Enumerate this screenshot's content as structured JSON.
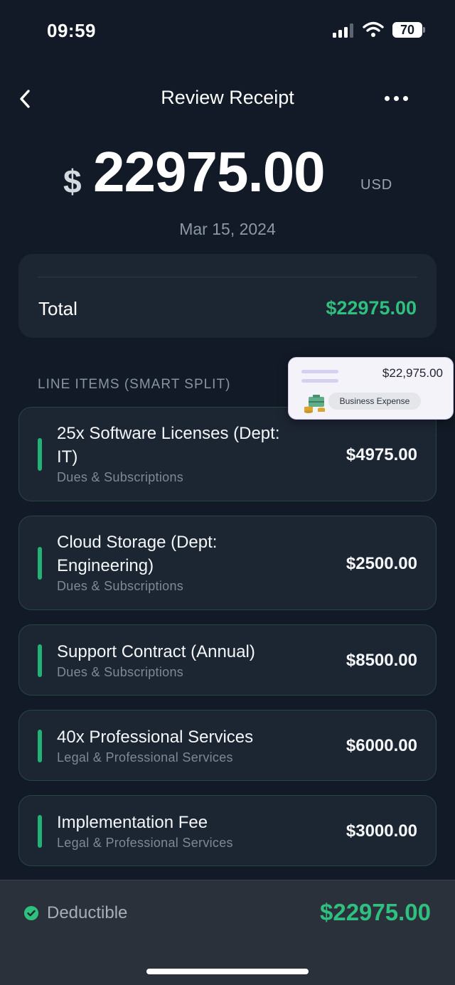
{
  "status_bar": {
    "time": "09:59",
    "battery": "70",
    "icons": [
      "signal-icon",
      "wifi-icon",
      "battery-icon"
    ]
  },
  "header": {
    "title": "Review Receipt",
    "back_icon": "chevron-left-icon",
    "more_icon": "more-horizontal-icon"
  },
  "amount": {
    "currency_symbol": "$",
    "value": "22975.00",
    "currency_code": "USD",
    "date": "Mar 15, 2024"
  },
  "total": {
    "label": "Total",
    "value": "$22975.00"
  },
  "line_items": {
    "section_title": "LINE ITEMS (SMART SPLIT)",
    "items": [
      {
        "name": "25x Software Licenses (Dept: IT)",
        "category": "Dues & Subscriptions",
        "amount": "$4975.00"
      },
      {
        "name": "Cloud Storage (Dept: Engineering)",
        "category": "Dues & Subscriptions",
        "amount": "$2500.00"
      },
      {
        "name": "Support Contract (Annual)",
        "category": "Dues & Subscriptions",
        "amount": "$8500.00"
      },
      {
        "name": "40x Professional Services",
        "category": "Legal & Professional Services",
        "amount": "$6000.00"
      },
      {
        "name": "Implementation Fee",
        "category": "Legal & Professional Services",
        "amount": "$3000.00"
      }
    ]
  },
  "popup": {
    "amount": "$22,975.00",
    "chip": "Business Expense",
    "icon": "briefcase-money-icon"
  },
  "footer": {
    "label": "Deductible",
    "value": "$22975.00",
    "icon": "check-circle-icon"
  },
  "colors": {
    "background": "#111a26",
    "card": "#1c2532",
    "accent_green": "#2fbf7e"
  }
}
